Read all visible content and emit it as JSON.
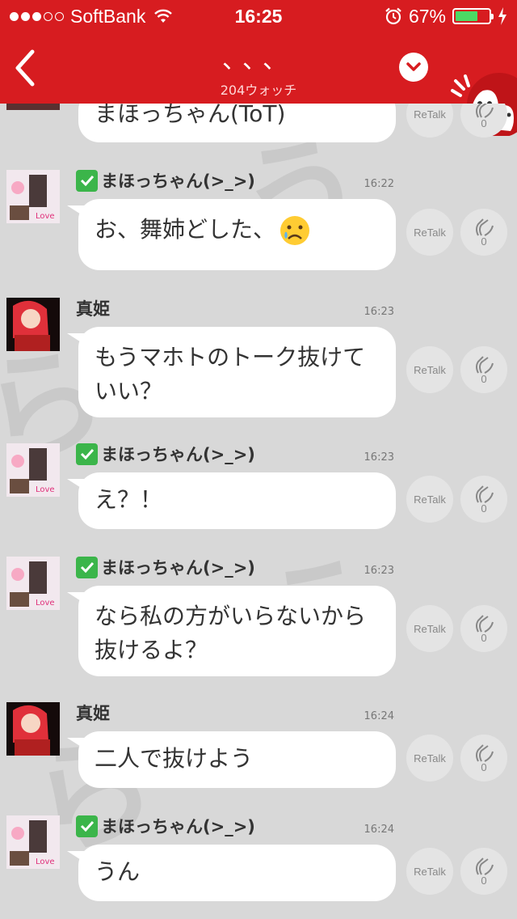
{
  "status_bar": {
    "signal_dots_full": 3,
    "signal_dots_total": 5,
    "carrier": "SoftBank",
    "time": "16:25",
    "battery_percent": "67%",
    "battery_level": 0.67,
    "icons": [
      "wifi-icon",
      "alarm-icon",
      "charging-icon"
    ]
  },
  "nav": {
    "title": "、、、",
    "subtitle": "204ウォッチ",
    "icons": [
      "back-chevron-icon",
      "chevron-down-icon",
      "mascot-icon"
    ]
  },
  "colors": {
    "header_red": "#d71c20",
    "background": "#d8d8d8",
    "bubble": "#ffffff",
    "check_green": "#3bb54a",
    "battery_green": "#4cd964"
  },
  "background_watermark": [
    "う",
    "ら",
    "う",
    "ら"
  ],
  "partial_message": {
    "text": "まほっちゃん(ToT)",
    "retalk_label": "ReTalk",
    "clap_count": "0"
  },
  "messages": [
    {
      "sender": "まほっちゃん(>_>)",
      "verified": true,
      "time": "16:22",
      "lines": [
        "お、舞姉どした、"
      ],
      "emoji": "sad-face-icon",
      "retalk_label": "ReTalk",
      "clap_count": "0"
    },
    {
      "sender": "真姫",
      "verified": false,
      "time": "16:23",
      "lines": [
        "もうマホトのトーク抜けて",
        "いい？"
      ],
      "retalk_label": "ReTalk",
      "clap_count": "0"
    },
    {
      "sender": "まほっちゃん(>_>)",
      "verified": true,
      "time": "16:23",
      "lines": [
        "え？！"
      ],
      "retalk_label": "ReTalk",
      "clap_count": "0"
    },
    {
      "sender": "まほっちゃん(>_>)",
      "verified": true,
      "time": "16:23",
      "lines": [
        "なら私の方がいらないから",
        "抜けるよ？"
      ],
      "retalk_label": "ReTalk",
      "clap_count": "0"
    },
    {
      "sender": "真姫",
      "verified": false,
      "time": "16:24",
      "lines": [
        "二人で抜けよう"
      ],
      "retalk_label": "ReTalk",
      "clap_count": "0"
    },
    {
      "sender": "まほっちゃん(>_>)",
      "verified": true,
      "time": "16:24",
      "lines": [
        "うん"
      ],
      "retalk_label": "ReTalk",
      "clap_count": "0"
    }
  ]
}
